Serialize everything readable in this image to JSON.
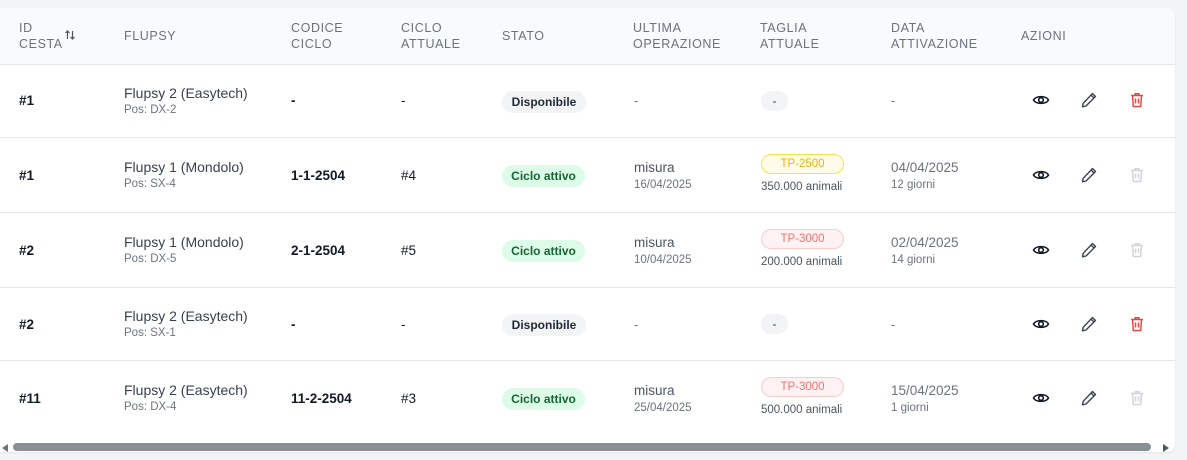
{
  "headers": {
    "id_l1": "ID",
    "id_l2": "CESTA",
    "flupsy": "FLUPSY",
    "codice_l1": "CODICE",
    "codice_l2": "CICLO",
    "ciclo_l1": "CICLO",
    "ciclo_l2": "ATTUALE",
    "stato": "STATO",
    "ultima_l1": "ULTIMA",
    "ultima_l2": "OPERAZIONE",
    "taglia_l1": "TAGLIA",
    "taglia_l2": "ATTUALE",
    "data_l1": "DATA",
    "data_l2": "ATTIVAZIONE",
    "azioni": "AZIONI"
  },
  "icons": {
    "sort": "sort-arrows-icon",
    "view": "eye-icon",
    "edit": "pencil-icon",
    "delete": "trash-icon"
  },
  "colors": {
    "delete_enabled": "#ef4444",
    "delete_disabled": "#d1d5db",
    "badge_active": "#dcfce7",
    "badge_available": "#f3f4f6"
  },
  "rows": [
    {
      "id": "#1",
      "flupsy": "Flupsy 2 (Easytech)",
      "pos": "Pos: DX-2",
      "codice": "-",
      "ciclo": "-",
      "stato": "Disponibile",
      "op": "-",
      "op_date": "",
      "taglia": "-",
      "animali": "",
      "data": "-",
      "giorni": ""
    },
    {
      "id": "#1",
      "flupsy": "Flupsy 1 (Mondolo)",
      "pos": "Pos: SX-4",
      "codice": "1-1-2504",
      "ciclo": "#4",
      "stato": "Ciclo attivo",
      "op": "misura",
      "op_date": "16/04/2025",
      "taglia": "TP-2500",
      "animali": "350.000 animali",
      "data": "04/04/2025",
      "giorni": "12 giorni"
    },
    {
      "id": "#2",
      "flupsy": "Flupsy 1 (Mondolo)",
      "pos": "Pos: DX-5",
      "codice": "2-1-2504",
      "ciclo": "#5",
      "stato": "Ciclo attivo",
      "op": "misura",
      "op_date": "10/04/2025",
      "taglia": "TP-3000",
      "animali": "200.000 animali",
      "data": "02/04/2025",
      "giorni": "14 giorni"
    },
    {
      "id": "#2",
      "flupsy": "Flupsy 2 (Easytech)",
      "pos": "Pos: SX-1",
      "codice": "-",
      "ciclo": "-",
      "stato": "Disponibile",
      "op": "-",
      "op_date": "",
      "taglia": "-",
      "animali": "",
      "data": "-",
      "giorni": ""
    },
    {
      "id": "#11",
      "flupsy": "Flupsy 2 (Easytech)",
      "pos": "Pos: DX-4",
      "codice": "11-2-2504",
      "ciclo": "#3",
      "stato": "Ciclo attivo",
      "op": "misura",
      "op_date": "25/04/2025",
      "taglia": "TP-3000",
      "animali": "500.000 animali",
      "data": "15/04/2025",
      "giorni": "1 giorni"
    }
  ]
}
